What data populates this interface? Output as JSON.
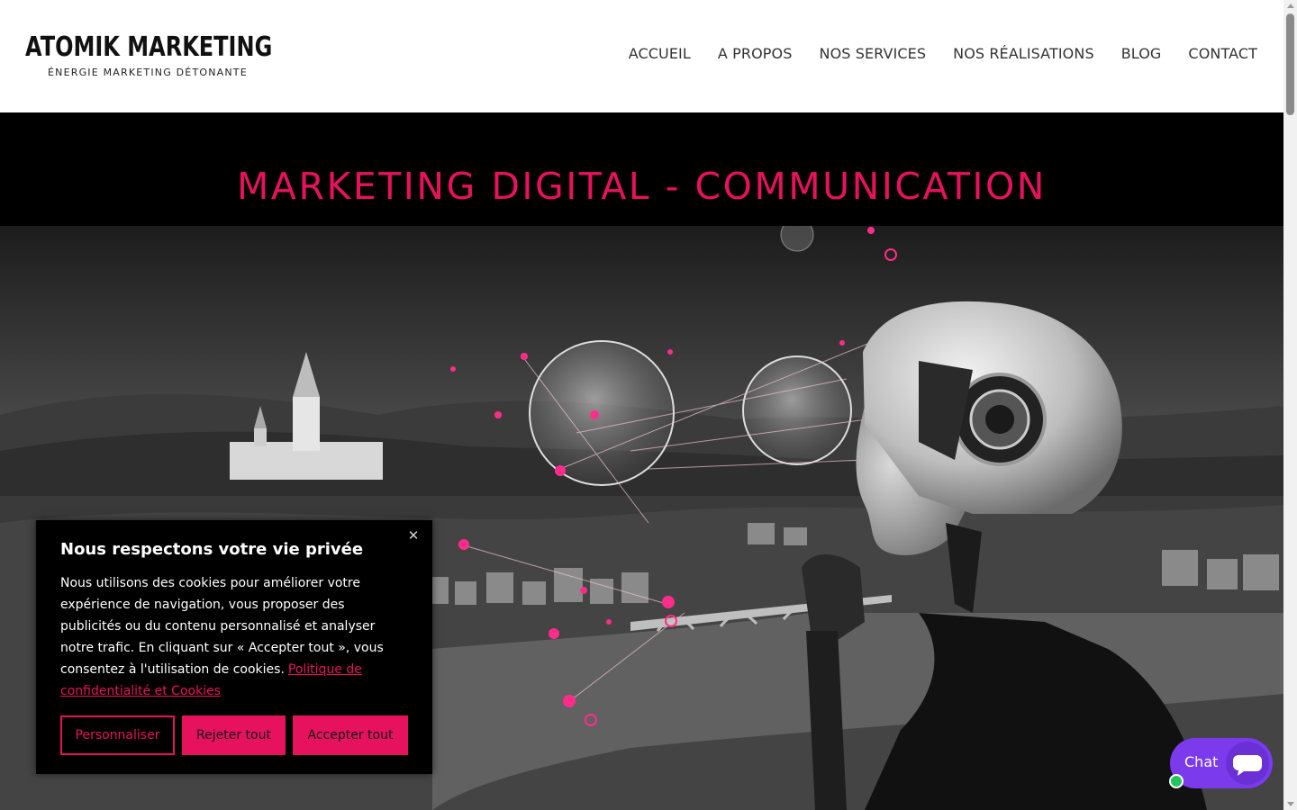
{
  "brand": {
    "name": "ATOMIK MARKETING",
    "tagline": "ÉNERGIE MARKETING DÉTONANTE",
    "accent_color": "#e7125e"
  },
  "nav": {
    "items": [
      {
        "label": "ACCUEIL"
      },
      {
        "label": "A PROPOS"
      },
      {
        "label": "NOS SERVICES"
      },
      {
        "label": "NOS RÉALISATIONS"
      },
      {
        "label": "BLOG"
      },
      {
        "label": "CONTACT"
      }
    ]
  },
  "hero": {
    "title": "MARKETING DIGITAL - COMMUNICATION",
    "image_icon": "ai-robot-city-image"
  },
  "cookie_banner": {
    "close_icon": "close-icon",
    "title": "Nous respectons votre vie privée",
    "body": "Nous utilisons des cookies pour améliorer votre expérience de navigation, vous proposer des publicités ou du contenu personnalisé et analyser notre trafic. En cliquant sur « Accepter tout », vous consentez à l'utilisation de cookies.",
    "policy_link": "Politique de confidentialité et Cookies",
    "buttons": {
      "customize": "Personnaliser",
      "reject": "Rejeter tout",
      "accept": "Accepter tout"
    }
  },
  "chat": {
    "label": "Chat",
    "icon": "chat-bubble-icon",
    "color": "#7c3aed",
    "status_color": "#22c55e"
  }
}
